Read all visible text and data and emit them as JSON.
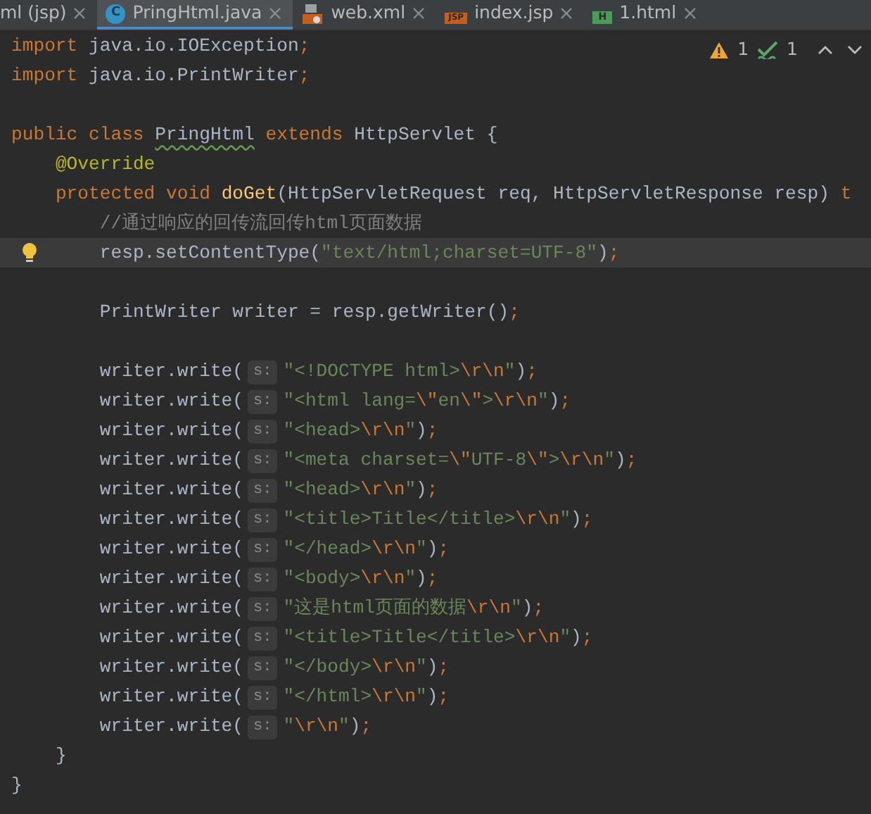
{
  "tabs": [
    {
      "label": "ml (jsp)",
      "kind": "plain",
      "selected": false
    },
    {
      "label": "PringHtml.java",
      "kind": "class",
      "icon_text": "C",
      "selected": true
    },
    {
      "label": "web.xml",
      "kind": "xml",
      "selected": false
    },
    {
      "label": "index.jsp",
      "kind": "jsp",
      "icon_text": "JSP",
      "selected": false
    },
    {
      "label": "1.html",
      "kind": "html",
      "icon_text": "H",
      "selected": false
    }
  ],
  "inspections": {
    "warnings": "1",
    "passed": "1"
  },
  "lines": [
    {
      "kind": "code",
      "segments": [
        {
          "kind": "code",
          "tokens": [
            {
              "kind": "keyword",
              "text": "import"
            },
            {
              "kind": "plain",
              "text": " java.io.IOException"
            },
            {
              "kind": "keyword",
              "text": ";"
            }
          ]
        }
      ]
    },
    {
      "kind": "code",
      "segments": [
        {
          "kind": "code",
          "tokens": [
            {
              "kind": "keyword",
              "text": "import"
            },
            {
              "kind": "plain",
              "text": " java.io.PrintWriter"
            },
            {
              "kind": "keyword",
              "text": ";"
            }
          ]
        }
      ]
    },
    {
      "kind": "blank"
    },
    {
      "kind": "code",
      "segments": [
        {
          "kind": "code",
          "tokens": [
            {
              "kind": "keyword",
              "text": "public class "
            },
            {
              "kind": "plain",
              "text": "PringHtml",
              "warned": true
            },
            {
              "kind": "keyword",
              "text": " extends "
            },
            {
              "kind": "plain",
              "text": "HttpServlet {"
            }
          ]
        }
      ]
    },
    {
      "kind": "code",
      "segments": [
        {
          "kind": "code",
          "tokens": [
            {
              "kind": "annotation",
              "text": "    @Override"
            }
          ]
        }
      ]
    },
    {
      "kind": "code",
      "segments": [
        {
          "kind": "code",
          "tokens": [
            {
              "kind": "keyword",
              "text": "    protected void "
            },
            {
              "kind": "method",
              "text": "doGet"
            },
            {
              "kind": "plain",
              "text": "(HttpServletRequest req, HttpServletResponse resp) "
            },
            {
              "kind": "keyword",
              "text": "t"
            }
          ]
        }
      ]
    },
    {
      "kind": "code",
      "segments": [
        {
          "kind": "code",
          "tokens": [
            {
              "kind": "comment",
              "text": "        //通过响应的回传流回传html页面数据"
            }
          ]
        }
      ]
    },
    {
      "kind": "code",
      "current": true,
      "bulb": true,
      "segments": [
        {
          "kind": "code",
          "tokens": [
            {
              "kind": "plain",
              "text": "        resp.setContentType("
            },
            {
              "kind": "string",
              "text": "\"text/html;charset=UTF-8\""
            },
            {
              "kind": "plain",
              "text": ")"
            },
            {
              "kind": "keyword",
              "text": ";"
            }
          ]
        }
      ]
    },
    {
      "kind": "blank"
    },
    {
      "kind": "code",
      "segments": [
        {
          "kind": "code",
          "tokens": [
            {
              "kind": "plain",
              "text": "        PrintWriter writer = resp.getWriter()"
            },
            {
              "kind": "keyword",
              "text": ";"
            }
          ]
        }
      ]
    },
    {
      "kind": "blank"
    },
    {
      "kind": "code",
      "segments": [
        {
          "kind": "code",
          "tokens": [
            {
              "kind": "plain",
              "text": "        writer.write("
            }
          ]
        },
        {
          "kind": "hint",
          "text": "s:"
        },
        {
          "kind": "code",
          "tokens": [
            {
              "kind": "string",
              "text": "\"<!DOCTYPE html>"
            },
            {
              "kind": "escape",
              "text": "\\r\\n"
            },
            {
              "kind": "string",
              "text": "\""
            },
            {
              "kind": "plain",
              "text": ")"
            },
            {
              "kind": "keyword",
              "text": ";"
            }
          ]
        }
      ]
    },
    {
      "kind": "code",
      "segments": [
        {
          "kind": "code",
          "tokens": [
            {
              "kind": "plain",
              "text": "        writer.write("
            }
          ]
        },
        {
          "kind": "hint",
          "text": "s:"
        },
        {
          "kind": "code",
          "tokens": [
            {
              "kind": "string",
              "text": "\"<html lang="
            },
            {
              "kind": "escape",
              "text": "\\\""
            },
            {
              "kind": "string",
              "text": "en"
            },
            {
              "kind": "escape",
              "text": "\\\""
            },
            {
              "kind": "string",
              "text": ">"
            },
            {
              "kind": "escape",
              "text": "\\r\\n"
            },
            {
              "kind": "string",
              "text": "\""
            },
            {
              "kind": "plain",
              "text": ")"
            },
            {
              "kind": "keyword",
              "text": ";"
            }
          ]
        }
      ]
    },
    {
      "kind": "code",
      "segments": [
        {
          "kind": "code",
          "tokens": [
            {
              "kind": "plain",
              "text": "        writer.write("
            }
          ]
        },
        {
          "kind": "hint",
          "text": "s:"
        },
        {
          "kind": "code",
          "tokens": [
            {
              "kind": "string",
              "text": "\"<head>"
            },
            {
              "kind": "escape",
              "text": "\\r\\n"
            },
            {
              "kind": "string",
              "text": "\""
            },
            {
              "kind": "plain",
              "text": ")"
            },
            {
              "kind": "keyword",
              "text": ";"
            }
          ]
        }
      ]
    },
    {
      "kind": "code",
      "segments": [
        {
          "kind": "code",
          "tokens": [
            {
              "kind": "plain",
              "text": "        writer.write("
            }
          ]
        },
        {
          "kind": "hint",
          "text": "s:"
        },
        {
          "kind": "code",
          "tokens": [
            {
              "kind": "string",
              "text": "\"<meta charset="
            },
            {
              "kind": "escape",
              "text": "\\\""
            },
            {
              "kind": "string",
              "text": "UTF-8"
            },
            {
              "kind": "escape",
              "text": "\\\""
            },
            {
              "kind": "string",
              "text": ">"
            },
            {
              "kind": "escape",
              "text": "\\r\\n"
            },
            {
              "kind": "string",
              "text": "\""
            },
            {
              "kind": "plain",
              "text": ")"
            },
            {
              "kind": "keyword",
              "text": ";"
            }
          ]
        }
      ]
    },
    {
      "kind": "code",
      "segments": [
        {
          "kind": "code",
          "tokens": [
            {
              "kind": "plain",
              "text": "        writer.write("
            }
          ]
        },
        {
          "kind": "hint",
          "text": "s:"
        },
        {
          "kind": "code",
          "tokens": [
            {
              "kind": "string",
              "text": "\"<head>"
            },
            {
              "kind": "escape",
              "text": "\\r\\n"
            },
            {
              "kind": "string",
              "text": "\""
            },
            {
              "kind": "plain",
              "text": ")"
            },
            {
              "kind": "keyword",
              "text": ";"
            }
          ]
        }
      ]
    },
    {
      "kind": "code",
      "segments": [
        {
          "kind": "code",
          "tokens": [
            {
              "kind": "plain",
              "text": "        writer.write("
            }
          ]
        },
        {
          "kind": "hint",
          "text": "s:"
        },
        {
          "kind": "code",
          "tokens": [
            {
              "kind": "string",
              "text": "\"<title>Title</title>"
            },
            {
              "kind": "escape",
              "text": "\\r\\n"
            },
            {
              "kind": "string",
              "text": "\""
            },
            {
              "kind": "plain",
              "text": ")"
            },
            {
              "kind": "keyword",
              "text": ";"
            }
          ]
        }
      ]
    },
    {
      "kind": "code",
      "segments": [
        {
          "kind": "code",
          "tokens": [
            {
              "kind": "plain",
              "text": "        writer.write("
            }
          ]
        },
        {
          "kind": "hint",
          "text": "s:"
        },
        {
          "kind": "code",
          "tokens": [
            {
              "kind": "string",
              "text": "\"</head>"
            },
            {
              "kind": "escape",
              "text": "\\r\\n"
            },
            {
              "kind": "string",
              "text": "\""
            },
            {
              "kind": "plain",
              "text": ")"
            },
            {
              "kind": "keyword",
              "text": ";"
            }
          ]
        }
      ]
    },
    {
      "kind": "code",
      "segments": [
        {
          "kind": "code",
          "tokens": [
            {
              "kind": "plain",
              "text": "        writer.write("
            }
          ]
        },
        {
          "kind": "hint",
          "text": "s:"
        },
        {
          "kind": "code",
          "tokens": [
            {
              "kind": "string",
              "text": "\"<body>"
            },
            {
              "kind": "escape",
              "text": "\\r\\n"
            },
            {
              "kind": "string",
              "text": "\""
            },
            {
              "kind": "plain",
              "text": ")"
            },
            {
              "kind": "keyword",
              "text": ";"
            }
          ]
        }
      ]
    },
    {
      "kind": "code",
      "segments": [
        {
          "kind": "code",
          "tokens": [
            {
              "kind": "plain",
              "text": "        writer.write("
            }
          ]
        },
        {
          "kind": "hint",
          "text": "s:"
        },
        {
          "kind": "code",
          "tokens": [
            {
              "kind": "string",
              "text": "\"这是html页面的数据"
            },
            {
              "kind": "escape",
              "text": "\\r\\n"
            },
            {
              "kind": "string",
              "text": "\""
            },
            {
              "kind": "plain",
              "text": ")"
            },
            {
              "kind": "keyword",
              "text": ";"
            }
          ]
        }
      ]
    },
    {
      "kind": "code",
      "segments": [
        {
          "kind": "code",
          "tokens": [
            {
              "kind": "plain",
              "text": "        writer.write("
            }
          ]
        },
        {
          "kind": "hint",
          "text": "s:"
        },
        {
          "kind": "code",
          "tokens": [
            {
              "kind": "string",
              "text": "\"<title>Title</title>"
            },
            {
              "kind": "escape",
              "text": "\\r\\n"
            },
            {
              "kind": "string",
              "text": "\""
            },
            {
              "kind": "plain",
              "text": ")"
            },
            {
              "kind": "keyword",
              "text": ";"
            }
          ]
        }
      ]
    },
    {
      "kind": "code",
      "segments": [
        {
          "kind": "code",
          "tokens": [
            {
              "kind": "plain",
              "text": "        writer.write("
            }
          ]
        },
        {
          "kind": "hint",
          "text": "s:"
        },
        {
          "kind": "code",
          "tokens": [
            {
              "kind": "string",
              "text": "\"</body>"
            },
            {
              "kind": "escape",
              "text": "\\r\\n"
            },
            {
              "kind": "string",
              "text": "\""
            },
            {
              "kind": "plain",
              "text": ")"
            },
            {
              "kind": "keyword",
              "text": ";"
            }
          ]
        }
      ]
    },
    {
      "kind": "code",
      "segments": [
        {
          "kind": "code",
          "tokens": [
            {
              "kind": "plain",
              "text": "        writer.write("
            }
          ]
        },
        {
          "kind": "hint",
          "text": "s:"
        },
        {
          "kind": "code",
          "tokens": [
            {
              "kind": "string",
              "text": "\"</html>"
            },
            {
              "kind": "escape",
              "text": "\\r\\n"
            },
            {
              "kind": "string",
              "text": "\""
            },
            {
              "kind": "plain",
              "text": ")"
            },
            {
              "kind": "keyword",
              "text": ";"
            }
          ]
        }
      ]
    },
    {
      "kind": "code",
      "segments": [
        {
          "kind": "code",
          "tokens": [
            {
              "kind": "plain",
              "text": "        writer.write("
            }
          ]
        },
        {
          "kind": "hint",
          "text": "s:"
        },
        {
          "kind": "code",
          "tokens": [
            {
              "kind": "string",
              "text": "\""
            },
            {
              "kind": "escape",
              "text": "\\r\\n"
            },
            {
              "kind": "string",
              "text": "\""
            },
            {
              "kind": "plain",
              "text": ")"
            },
            {
              "kind": "keyword",
              "text": ";"
            }
          ]
        }
      ]
    },
    {
      "kind": "code",
      "segments": [
        {
          "kind": "code",
          "tokens": [
            {
              "kind": "plain",
              "text": "    }"
            }
          ]
        }
      ]
    },
    {
      "kind": "code",
      "segments": [
        {
          "kind": "code",
          "tokens": [
            {
              "kind": "plain",
              "text": "}"
            }
          ]
        }
      ]
    }
  ]
}
